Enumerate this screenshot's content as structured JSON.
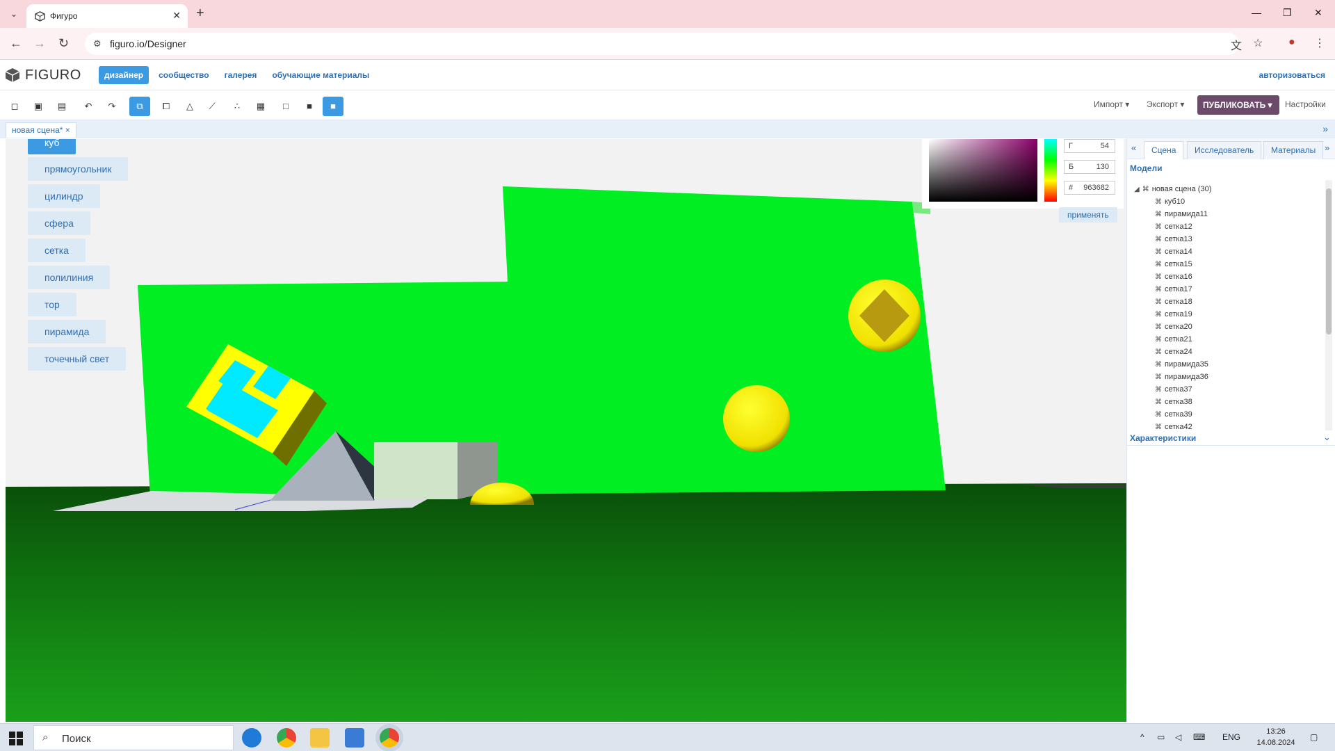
{
  "browser": {
    "tab_title": "Фигуро",
    "url": "figuro.io/Designer"
  },
  "app": {
    "logo_text": "FIGURO",
    "nav": [
      "дизайнер",
      "сообщество",
      "галерея",
      "обучающие материалы"
    ],
    "login": "авторизоваться"
  },
  "toolbar": {
    "import": "Импорт",
    "export": "Экспорт",
    "publish": "ПУБЛИКОВАТЬ",
    "settings": "Настройки"
  },
  "scene_tab": "новая сцена*",
  "shape_buttons": [
    "куб",
    "прямоугольник",
    "цилиндр",
    "сфера",
    "сетка",
    "полилиния",
    "тор",
    "пирамида",
    "точечный свет"
  ],
  "color_picker": {
    "g_label": "Г",
    "g_value": "54",
    "b_label": "Б",
    "b_value": "130",
    "hex_label": "#",
    "hex_value": "963682",
    "apply": "применять"
  },
  "right_panel": {
    "tabs": [
      "Сцена",
      "Исследователь",
      "Материалы"
    ],
    "models_title": "Модели",
    "tree_root": "новая сцена  (30)",
    "tree_items": [
      "куб10",
      "пирамида11",
      "сетка12",
      "сетка13",
      "сетка14",
      "сетка15",
      "сетка16",
      "сетка17",
      "сетка18",
      "сетка19",
      "сетка20",
      "сетка21",
      "сетка24",
      "пирамида35",
      "пирамида36",
      "сетка37",
      "сетка38",
      "сетка39",
      "сетка42"
    ],
    "characteristics_title": "Характеристики"
  },
  "taskbar": {
    "search": "Поиск",
    "lang": "ENG",
    "time": "13:26",
    "date": "14.08.2024"
  },
  "colors": {
    "accent": "#3b9ae1",
    "publish": "#6b4a6a",
    "ground": "#0d5e0d",
    "wall": "#00ee22"
  }
}
